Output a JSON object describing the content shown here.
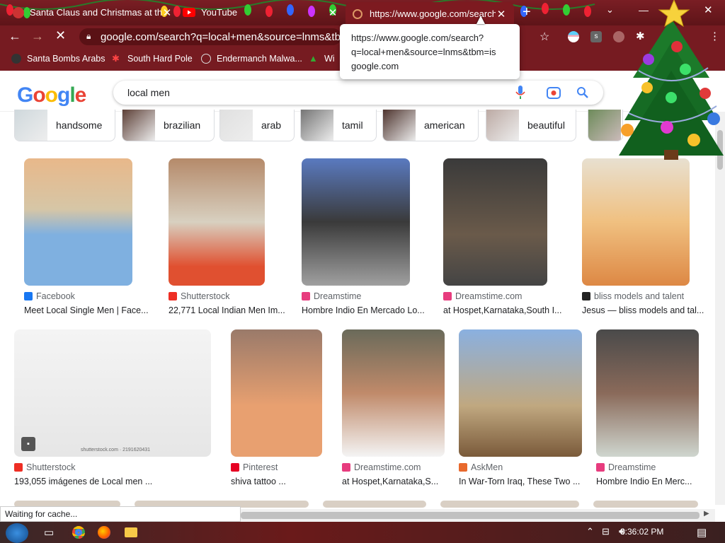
{
  "browser": {
    "tabs": [
      {
        "label": "Santa Claus and Christmas at the"
      },
      {
        "label": "YouTube"
      },
      {
        "label": "https://www.google.com/search"
      }
    ],
    "new_tab_label": "+",
    "omnibox_text": "google.com/search?q=local+men&source=lnms&tbm",
    "bookmarks": [
      {
        "label": "Santa Bombs Arabs"
      },
      {
        "label": "South Hard Pole"
      },
      {
        "label": "Endermanch Malwa..."
      },
      {
        "label": "Wi"
      }
    ],
    "tooltip_line1": "https://www.google.com/search?",
    "tooltip_line2": "q=local+men&source=lnms&tbm=is",
    "tooltip_line3": "google.com",
    "status_text": "Waiting for cache..."
  },
  "google": {
    "logo_letters": [
      "G",
      "o",
      "o",
      "g",
      "l",
      "e"
    ],
    "logo_colors": [
      "#4285f4",
      "#ea4335",
      "#fbbc05",
      "#4285f4",
      "#34a853",
      "#ea4335"
    ],
    "search_value": "local men",
    "chips": [
      "handsome",
      "brazilian",
      "arab",
      "tamil",
      "american",
      "beautiful"
    ],
    "row1": [
      {
        "source": "Facebook",
        "title": "Meet Local Single Men | Face...",
        "fav": "#1877f2"
      },
      {
        "source": "Shutterstock",
        "title": "22,771 Local Indian Men Im...",
        "fav": "#ee2e24"
      },
      {
        "source": "Dreamstime",
        "title": "Hombre Indio En Mercado Lo...",
        "fav": "#e73c7e"
      },
      {
        "source": "Dreamstime.com",
        "title": "at Hospet,Karnataka,South I...",
        "fav": "#e73c7e"
      },
      {
        "source": "bliss models and talent",
        "title": "Jesus — bliss models and tal...",
        "fav": "#222222"
      }
    ],
    "row2": [
      {
        "source": "Shutterstock",
        "title": "193,055 imágenes de Local men ...",
        "fav": "#ee2e24"
      },
      {
        "source": "Pinterest",
        "title": "shiva tattoo ...",
        "fav": "#e60023"
      },
      {
        "source": "Dreamstime.com",
        "title": "at Hospet,Karnataka,S...",
        "fav": "#e73c7e"
      },
      {
        "source": "AskMen",
        "title": "In War-Torn Iraq, These Two ...",
        "fav": "#e8692d"
      },
      {
        "source": "Dreamstime",
        "title": "Hombre Indio En Merc...",
        "fav": "#e73c7e"
      }
    ],
    "watermark": "shutterstock.com · 2191620431"
  },
  "taskbar": {
    "clock": "3:36:02 PM"
  }
}
